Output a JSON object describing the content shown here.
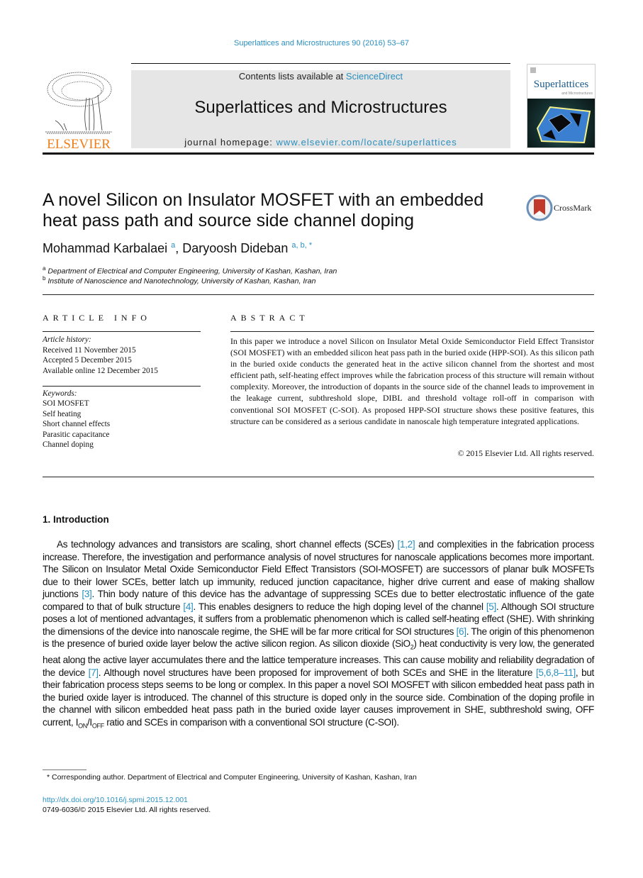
{
  "citation": "Superlattices and Microstructures 90 (2016) 53–67",
  "header": {
    "publisher_word": "ELSEVIER",
    "contents_prefix": "Contents lists available at ",
    "contents_link": "ScienceDirect",
    "journal_name": "Superlattices and Microstructures",
    "homepage_prefix": "journal homepage: ",
    "homepage_link": "www.elsevier.com/locate/superlattices",
    "cover_title": "Superlattices",
    "cover_subtitle": "and Microstructures"
  },
  "article": {
    "title": "A novel Silicon on Insulator MOSFET with an embedded heat pass path and source side channel doping",
    "crossmark_label": "CrossMark",
    "authors": [
      {
        "name": "Mohammad Karbalaei",
        "sup": "a"
      },
      {
        "name": "Daryoosh Dideban",
        "sup": "a, b, *"
      }
    ],
    "affiliations": [
      {
        "mark": "a",
        "text": "Department of Electrical and Computer Engineering, University of Kashan, Kashan, Iran"
      },
      {
        "mark": "b",
        "text": "Institute of Nanoscience and Nanotechnology, University of Kashan, Kashan, Iran"
      }
    ]
  },
  "article_info": {
    "heading": "ARTICLE INFO",
    "history_label": "Article history:",
    "history": [
      "Received 11 November 2015",
      "Accepted 5 December 2015",
      "Available online 12 December 2015"
    ],
    "keywords_label": "Keywords:",
    "keywords": [
      "SOI MOSFET",
      "Self heating",
      "Short channel effects",
      "Parasitic capacitance",
      "Channel doping"
    ]
  },
  "abstract": {
    "heading": "ABSTRACT",
    "text": "In this paper we introduce a novel Silicon on Insulator Metal Oxide Semiconductor Field Effect Transistor (SOI MOSFET) with an embedded silicon heat pass path in the buried oxide (HPP-SOI). As this silicon path in the buried oxide conducts the generated heat in the active silicon channel from the shortest and most efficient path, self-heating effect improves while the fabrication process of this structure will remain without complexity. Moreover, the introduction of dopants in the source side of the channel leads to improvement in the leakage current, subthreshold slope, DIBL and threshold voltage roll-off in comparison with conventional SOI MOSFET (C-SOI). As proposed HPP-SOI structure shows these positive features, this structure can be considered as a serious candidate in nanoscale high temperature integrated applications.",
    "copyright": "© 2015 Elsevier Ltd. All rights reserved."
  },
  "introduction": {
    "heading": "1.  Introduction",
    "segments": [
      {
        "t": "As technology advances and transistors are scaling, short channel effects (SCEs) "
      },
      {
        "ref": "[1,2]"
      },
      {
        "t": " and complexities in the fabrication process increase. Therefore, the investigation and performance analysis of novel structures for nanoscale applications becomes more important. The Silicon on Insulator Metal Oxide Semiconductor Field Effect Transistors (SOI-MOSFET) are successors of planar bulk MOSFETs due to their lower SCEs, better latch up immunity, reduced junction capacitance, higher drive current and ease of making shallow junctions "
      },
      {
        "ref": "[3]"
      },
      {
        "t": ". Thin body nature of this device has the advantage of suppressing SCEs due to better electrostatic influence of the gate compared to that of bulk structure "
      },
      {
        "ref": "[4]"
      },
      {
        "t": ". This enables designers to reduce the high doping level of the channel "
      },
      {
        "ref": "[5]"
      },
      {
        "t": ". Although SOI structure poses a lot of mentioned advantages, it suffers from a problematic phenomenon which is called self-heating effect (SHE). With shrinking the dimensions of the device into nanoscale regime, the SHE will be far more critical for SOI structures "
      },
      {
        "ref": "[6]"
      },
      {
        "t": ". The origin of this phenomenon is the presence of buried oxide layer below the active silicon region. As silicon dioxide (SiO"
      },
      {
        "sub": "2"
      },
      {
        "t": ") heat conductivity is very low, the generated heat along the active layer accumulates there and the lattice temperature increases. This can cause mobility and reliability degradation of the device "
      },
      {
        "ref": "[7]"
      },
      {
        "t": ". Although novel structures have been proposed for improvement of both SCEs and SHE in the literature "
      },
      {
        "ref": "[5,6,8–11]"
      },
      {
        "t": ", but their fabrication process steps seems to be long or complex. In this paper a novel SOI MOSFET with silicon embedded heat pass path in the buried oxide layer is introduced. The channel of this structure is doped only in the source side. Combination of the doping profile in the channel with silicon embedded heat pass path in the buried oxide layer causes improvement in SHE, subthreshold swing, OFF current, I"
      },
      {
        "sub": "ON"
      },
      {
        "t": "/I"
      },
      {
        "sub": "OFF"
      },
      {
        "t": " ratio and SCEs in comparison with a conventional SOI structure (C-SOI)."
      }
    ]
  },
  "footer": {
    "footnote_mark": "*",
    "footnote": "Corresponding author. Department of Electrical and Computer Engineering, University of Kashan, Kashan, Iran",
    "doi": "http://dx.doi.org/10.1016/j.spmi.2015.12.001",
    "issn": "0749-6036/© 2015 Elsevier Ltd. All rights reserved."
  },
  "colors": {
    "link": "#2a8fbf",
    "elsevier_orange": "#f07e1a",
    "header_box": "#e6e6e6"
  }
}
